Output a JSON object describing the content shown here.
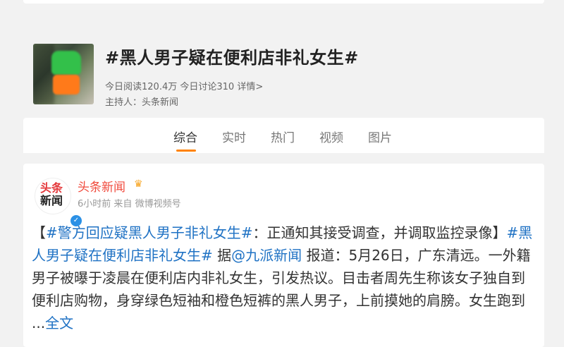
{
  "topic": {
    "title": "#黑人男子疑在便利店非礼女生#",
    "reads": "今日阅读120.4万",
    "discussions": "今日讨论310",
    "details": "详情>",
    "host_label": "主持人：",
    "host_name": "头条新闻"
  },
  "tabs": [
    {
      "label": "综合"
    },
    {
      "label": "实时"
    },
    {
      "label": "热门"
    },
    {
      "label": "视频"
    },
    {
      "label": "图片"
    }
  ],
  "post": {
    "author": "头条新闻",
    "avatar_logo_line1": "头条",
    "avatar_logo_line2": "新闻",
    "time": "6小时前",
    "source_prefix": "来自",
    "source": "微博视频号",
    "body": {
      "bracket_open": "【",
      "hashtag1": "#警方回应疑黑人男子非礼女生#",
      "colon_text": "：正通知其接受调查，并调取监控录像】",
      "hashtag2": "#黑人男子疑在便利店非礼女生#",
      "according": " 据",
      "mention": "@九派新闻",
      "report": " 报道：5月26日，广东清远。一外籍男子被曝于凌晨在便利店内非礼女生，引发热议。目击者周先生称该女子独自到便利店购物，身穿绿色短袖和橙色短裤的黑人男子，上前摸她的肩膀。女生跑到 ...",
      "full_text_link": "全文"
    }
  },
  "colors": {
    "accent_orange": "#ff8200",
    "author_red": "#f04a3c",
    "hashtag_orange": "#eb7350",
    "link_blue": "#1f72c4"
  },
  "icons": {
    "crown": "crown-icon",
    "verified": "verified-badge-icon"
  }
}
